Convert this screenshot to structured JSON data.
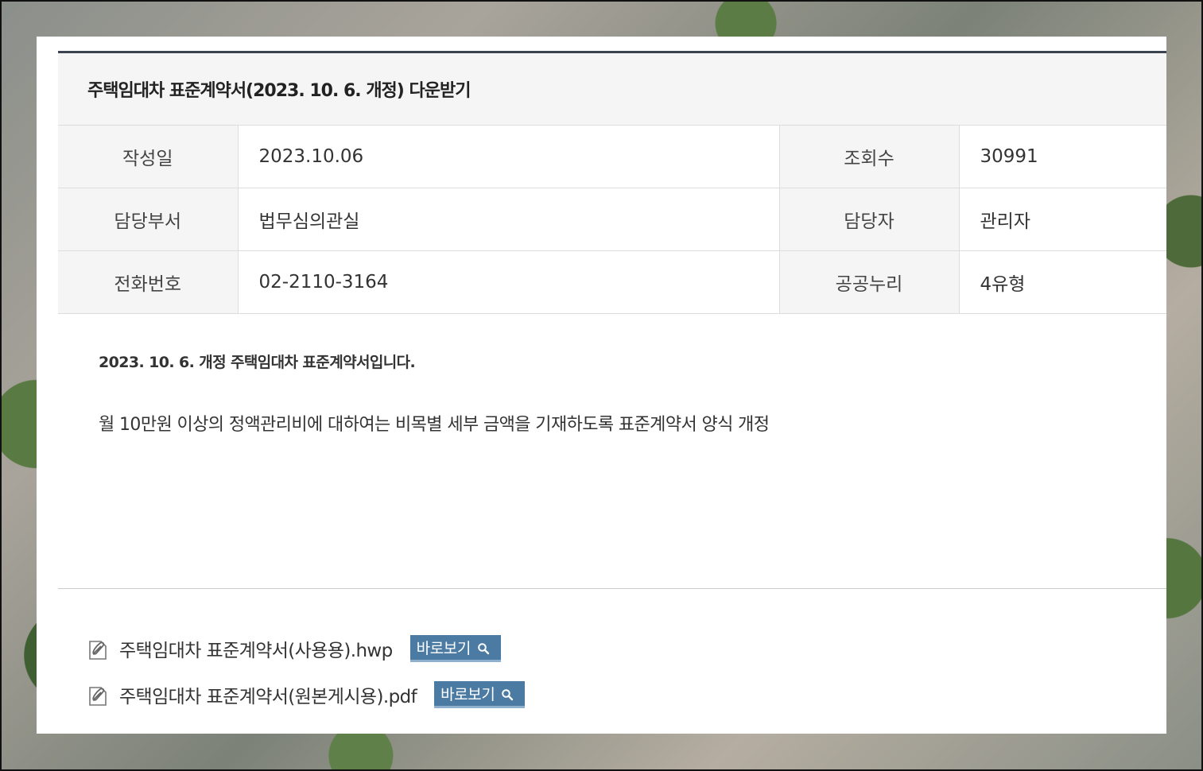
{
  "post": {
    "title": "주택임대차 표준계약서(2023. 10. 6. 개정) 다운받기"
  },
  "meta": {
    "date_label": "작성일",
    "date_value": "2023.10.06",
    "views_label": "조회수",
    "views_value": "30991",
    "dept_label": "담당부서",
    "dept_value": "법무심의관실",
    "manager_label": "담당자",
    "manager_value": "관리자",
    "phone_label": "전화번호",
    "phone_value": "02-2110-3164",
    "license_label": "공공누리",
    "license_value": "4유형"
  },
  "content": {
    "lead": "2023. 10. 6. 개정 주택임대차 표준계약서입니다.",
    "body": "월 10만원 이상의 정액관리비에 대하여는 비목별 세부 금액을 기재하도록 표준계약서 양식 개정"
  },
  "attachments": [
    {
      "name": "주택임대차 표준계약서(사용용).hwp",
      "view_label": "바로보기"
    },
    {
      "name": "주택임대차 표준계약서(원본게시용).pdf",
      "view_label": "바로보기"
    }
  ],
  "colors": {
    "button_bg": "#4b7aa2",
    "header_border": "#3b4350",
    "label_bg": "#f5f5f5"
  }
}
